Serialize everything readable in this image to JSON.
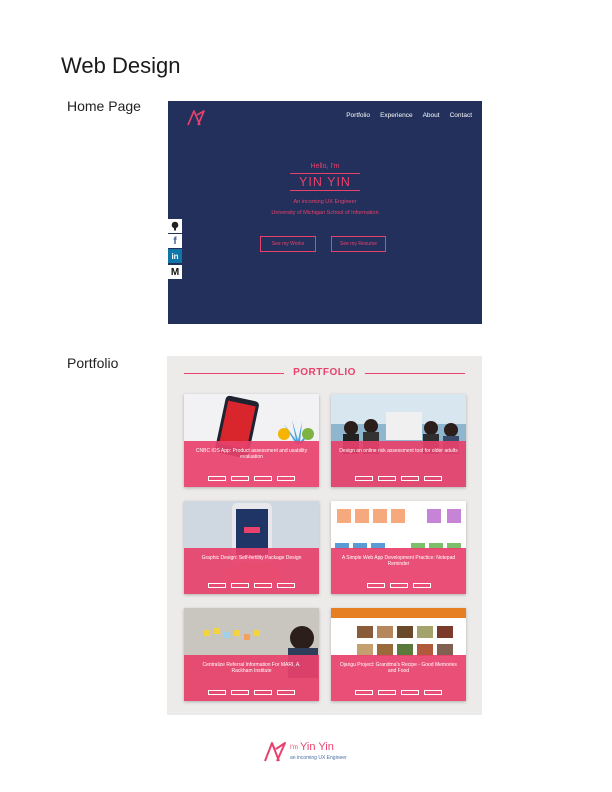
{
  "page": {
    "title": "Web Design",
    "sections": [
      "Home Page",
      "Portfolio"
    ]
  },
  "home": {
    "nav": [
      "Portfolio",
      "Experience",
      "About",
      "Contact"
    ],
    "greeting": "Hello, I'm",
    "name": "YIN YIN",
    "tagline1": "An incoming UX Engineer",
    "tagline2": "University of Michigan School of Information",
    "buttons": [
      "See my Works",
      "See my Resume"
    ],
    "social_icons": [
      "github-icon",
      "facebook-icon",
      "linkedin-icon",
      "medium-icon"
    ],
    "social_glyphs": [
      "",
      "f",
      "in",
      "M"
    ],
    "colors": {
      "background": "#22305b",
      "accent": "#e8416b"
    }
  },
  "portfolio": {
    "heading": "PORTFOLIO",
    "cards": [
      {
        "title": "CNBC iOS App: Product assessment and usability evaluation",
        "tag_count": 4
      },
      {
        "title": "Design an online risk assessment tool for older adults",
        "tag_count": 4
      },
      {
        "title": "Graphic Design: Self-fertility Package Design",
        "tag_count": 4
      },
      {
        "title": "A Simple Web App Development Practice: Notepad Reminder",
        "tag_count": 3
      },
      {
        "title": "Centralize Referral Information For MARI, A. Rackham Institute",
        "tag_count": 4
      },
      {
        "title": "Djangu Project: Grandma's Recipe - Good Memories and Food",
        "tag_count": 4
      }
    ],
    "colors": {
      "background": "#ecebe9",
      "accent": "#e8416b"
    }
  },
  "footer": {
    "prefix": "I'm",
    "name": "Yin Yin",
    "tagline": "an incoming UX Engineer"
  }
}
